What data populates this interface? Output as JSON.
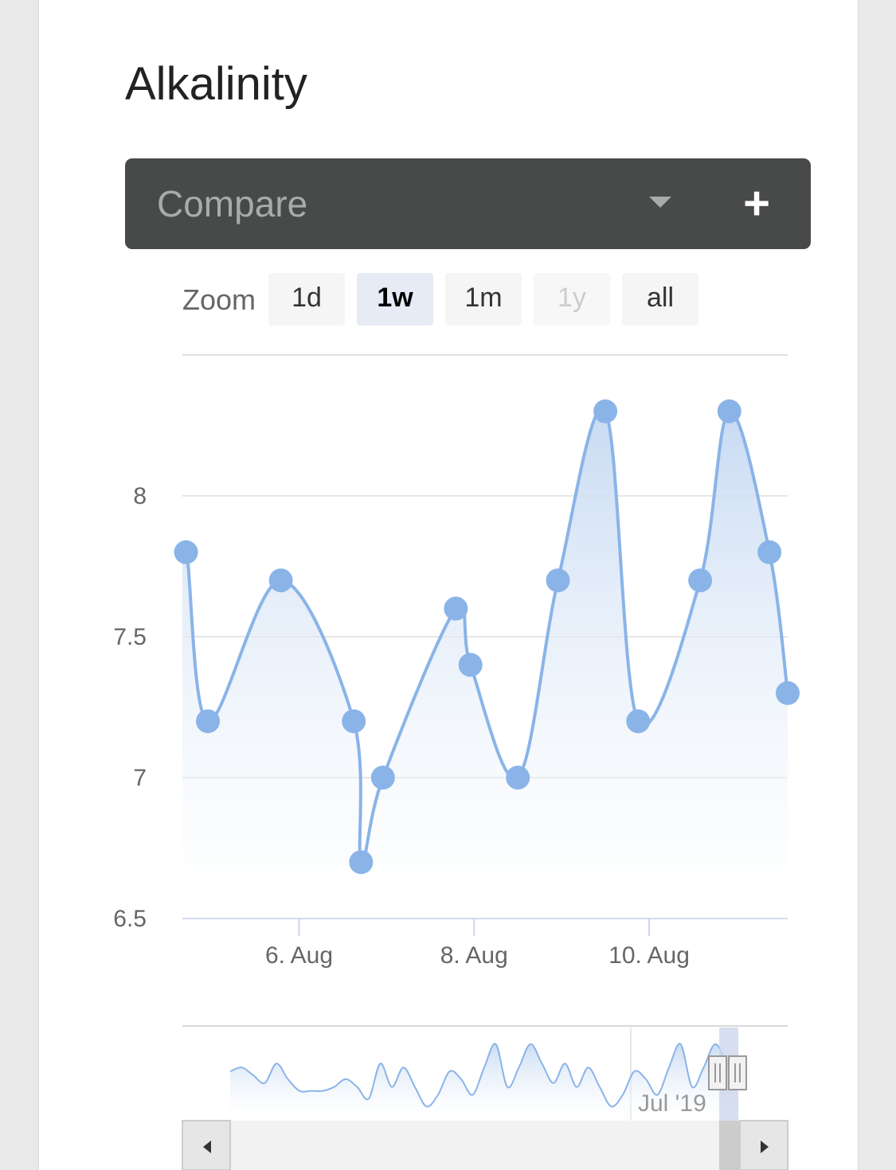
{
  "header": {
    "title": "Alkalinity"
  },
  "compare": {
    "placeholder": "Compare",
    "add_label": "+"
  },
  "zoom": {
    "label": "Zoom",
    "buttons": [
      {
        "label": "1d",
        "state": "normal"
      },
      {
        "label": "1w",
        "state": "active"
      },
      {
        "label": "1m",
        "state": "normal"
      },
      {
        "label": "1y",
        "state": "disabled"
      },
      {
        "label": "all",
        "state": "normal"
      }
    ]
  },
  "colors": {
    "series": "#8ab4e8",
    "fill_top": "#c4d8f2",
    "grid": "#e6e6e6",
    "navigator_mask": "#ccd6eb"
  },
  "chart_data": {
    "type": "area",
    "title": "Alkalinity",
    "xlabel": "",
    "ylabel": "",
    "x_ticks": [
      "6. Aug",
      "8. Aug",
      "10. Aug"
    ],
    "y_ticks": [
      "6.5",
      "7",
      "7.5",
      "8"
    ],
    "ylim": [
      6.5,
      8.5
    ],
    "xlim": [
      "2019-08-04 16:00",
      "2019-08-11 14:00"
    ],
    "series": [
      {
        "name": "",
        "x": [
          "2019-08-04 17:00",
          "2019-08-04 23:00",
          "2019-08-05 19:00",
          "2019-08-06 15:00",
          "2019-08-06 17:00",
          "2019-08-06 23:00",
          "2019-08-07 19:00",
          "2019-08-07 23:00",
          "2019-08-08 12:00",
          "2019-08-08 23:00",
          "2019-08-09 12:00",
          "2019-08-09 21:00",
          "2019-08-10 14:00",
          "2019-08-10 22:00",
          "2019-08-11 09:00",
          "2019-08-11 14:00"
        ],
        "values": [
          7.8,
          7.2,
          7.7,
          7.2,
          6.7,
          7.0,
          7.6,
          7.4,
          7.0,
          7.7,
          8.3,
          7.2,
          7.7,
          8.3,
          7.8,
          7.3
        ]
      }
    ],
    "navigator": {
      "x_label": "Jul '19"
    }
  }
}
